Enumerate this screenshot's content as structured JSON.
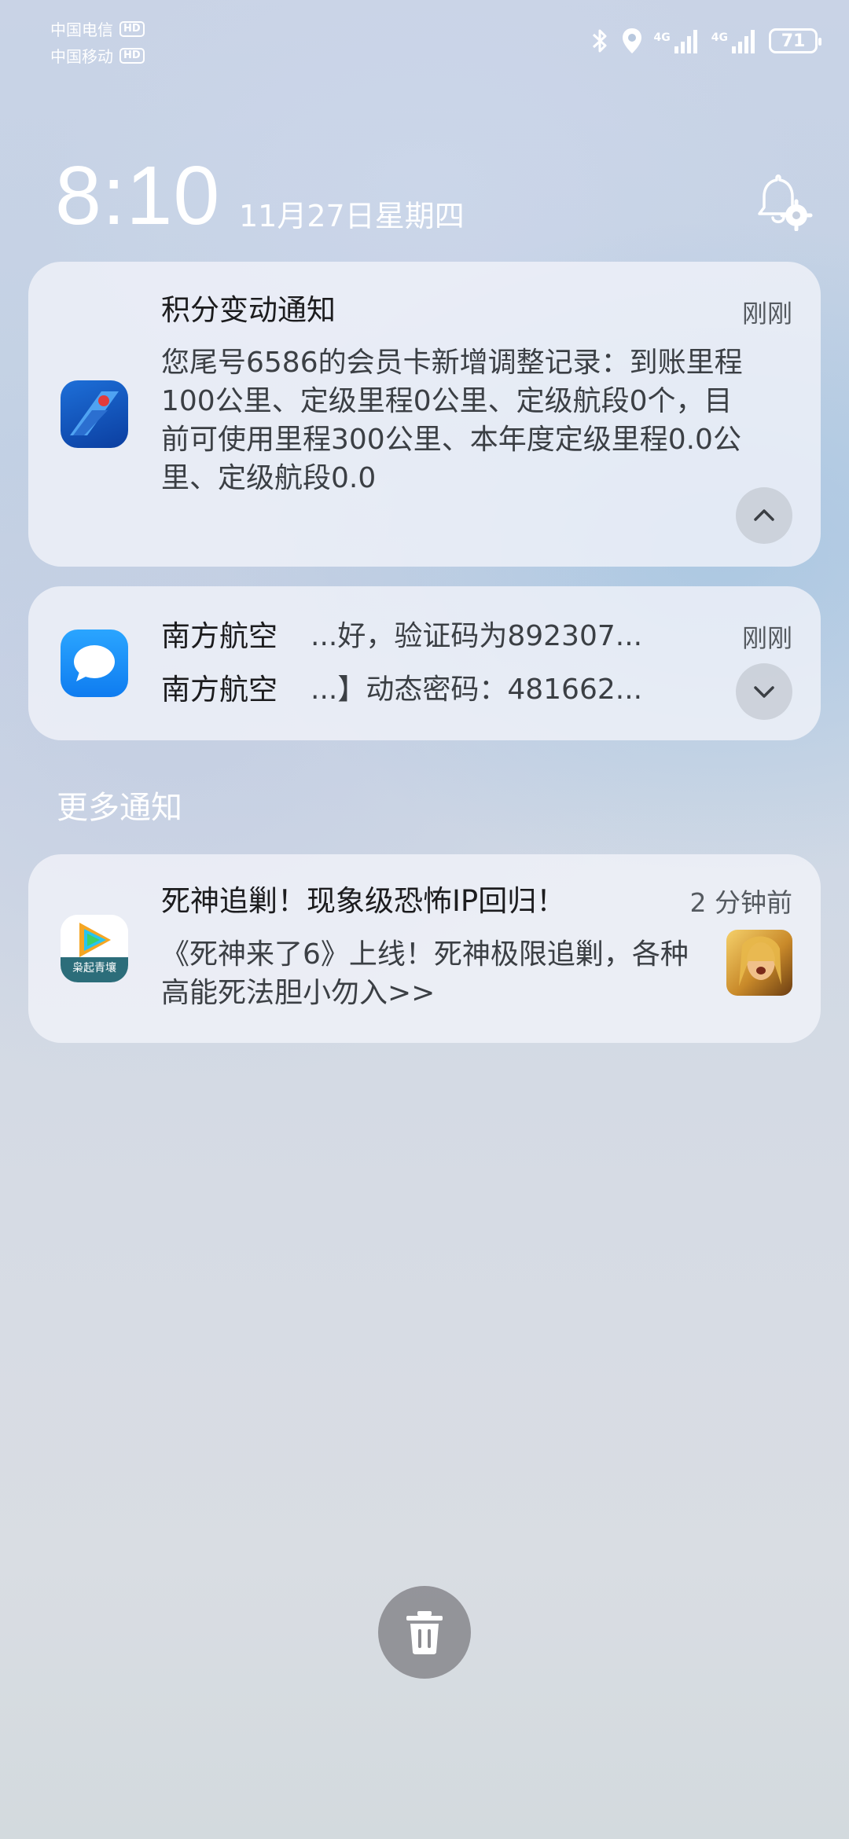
{
  "status_bar": {
    "carrier1": "中国电信",
    "carrier2": "中国移动",
    "hd_badge": "HD",
    "net1": "4G",
    "net2": "4G",
    "battery": "71",
    "icons": [
      "bluetooth-icon",
      "location-icon",
      "signal-icon",
      "battery-icon"
    ]
  },
  "clock": {
    "time": "8:10",
    "date": "11月27日星期四"
  },
  "notifications": [
    {
      "app_icon": "china-southern-airlines-icon",
      "title": "积分变动通知",
      "time": "刚刚",
      "body": "您尾号6586的会员卡新增调整记录：到账里程100公里、定级里程0公里、定级航段0个，目前可使用里程300公里、本年度定级里程0.0公里、定级航段0.0",
      "action_icon": "chevron-up-icon"
    },
    {
      "app_icon": "messages-icon",
      "time": "刚刚",
      "messages": [
        {
          "sender": "南方航空",
          "text": "...好，验证码为892307..."
        },
        {
          "sender": "南方航空",
          "text": "...】动态密码：481662..."
        }
      ],
      "action_icon": "chevron-down-icon"
    }
  ],
  "more_notifications_label": "更多通知",
  "more": [
    {
      "app_icon": "tencent-video-icon",
      "app_icon_text": "枭起青壤",
      "title": "死神追剿！现象级恐怖IP回归！",
      "time": "2 分钟前",
      "body": "《死神来了6》上线！死神极限追剿，各种高能死法胆小勿入>>",
      "thumbnail": "poster-thumbnail"
    }
  ],
  "colors": {
    "card_bg": "#f2f4fa",
    "text_primary": "#1c1c1e",
    "text_secondary": "#3b3f44",
    "trash_button": "#8c8c91"
  }
}
